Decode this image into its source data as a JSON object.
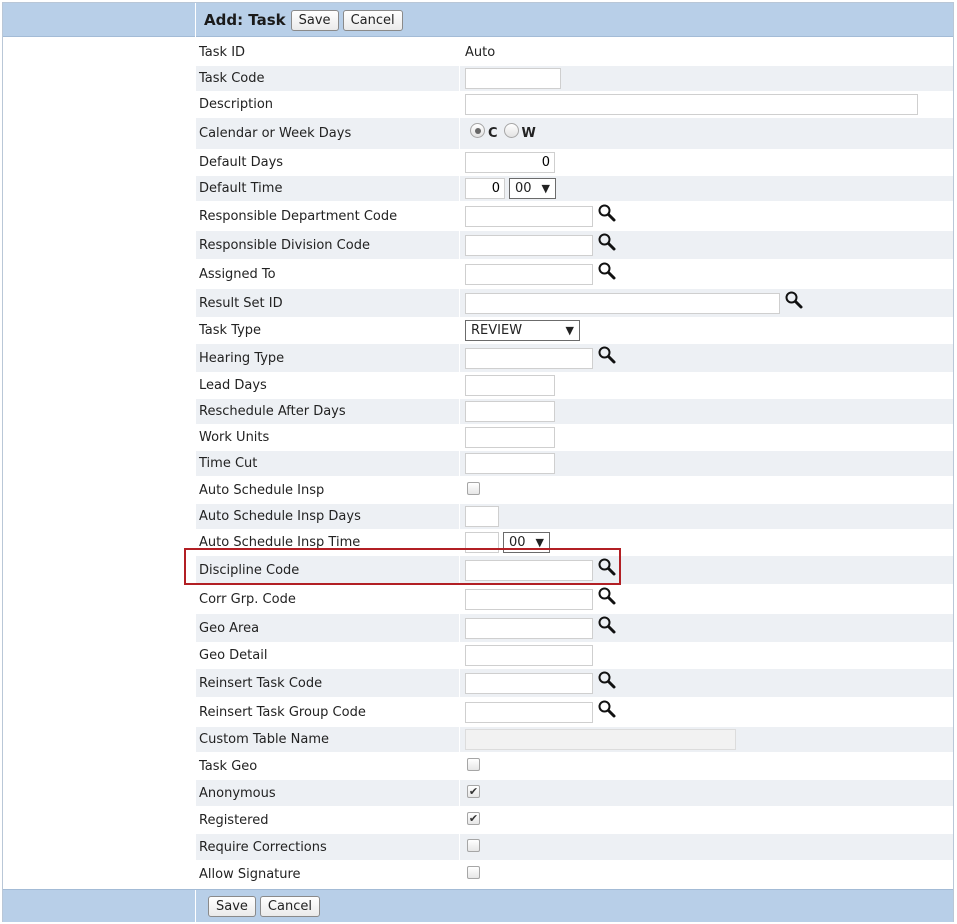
{
  "header": {
    "title": "Add: Task",
    "save_label": "Save",
    "cancel_label": "Cancel"
  },
  "footer": {
    "save_label": "Save",
    "cancel_label": "Cancel"
  },
  "fields": {
    "task_id": {
      "label": "Task ID",
      "value": "Auto"
    },
    "task_code": {
      "label": "Task Code",
      "value": ""
    },
    "description": {
      "label": "Description",
      "value": ""
    },
    "calendar_or_week_days": {
      "label": "Calendar or Week Days",
      "options": [
        "C",
        "W"
      ],
      "selected": "C"
    },
    "default_days": {
      "label": "Default Days",
      "value": "0"
    },
    "default_time": {
      "label": "Default Time",
      "hours": "0",
      "minutes": "00"
    },
    "responsible_department_code": {
      "label": "Responsible Department Code",
      "value": ""
    },
    "responsible_division_code": {
      "label": "Responsible Division Code",
      "value": ""
    },
    "assigned_to": {
      "label": "Assigned To",
      "value": ""
    },
    "result_set_id": {
      "label": "Result Set ID",
      "value": ""
    },
    "task_type": {
      "label": "Task Type",
      "selected": "REVIEW"
    },
    "hearing_type": {
      "label": "Hearing Type",
      "value": ""
    },
    "lead_days": {
      "label": "Lead Days",
      "value": ""
    },
    "reschedule_after_days": {
      "label": "Reschedule After Days",
      "value": ""
    },
    "work_units": {
      "label": "Work Units",
      "value": ""
    },
    "time_cut": {
      "label": "Time Cut",
      "value": ""
    },
    "auto_schedule_insp": {
      "label": "Auto Schedule Insp",
      "checked": false
    },
    "auto_schedule_insp_days": {
      "label": "Auto Schedule Insp Days",
      "value": ""
    },
    "auto_schedule_insp_time": {
      "label": "Auto Schedule Insp Time",
      "hours": "",
      "minutes": "00"
    },
    "discipline_code": {
      "label": "Discipline Code",
      "value": ""
    },
    "corr_grp_code": {
      "label": "Corr Grp. Code",
      "value": ""
    },
    "geo_area": {
      "label": "Geo Area",
      "value": ""
    },
    "geo_detail": {
      "label": "Geo Detail",
      "value": ""
    },
    "reinsert_task_code": {
      "label": "Reinsert Task Code",
      "value": ""
    },
    "reinsert_task_group_code": {
      "label": "Reinsert Task Group Code",
      "value": ""
    },
    "custom_table_name": {
      "label": "Custom Table Name",
      "value": ""
    },
    "task_geo": {
      "label": "Task Geo",
      "checked": false
    },
    "anonymous": {
      "label": "Anonymous",
      "checked": true
    },
    "registered": {
      "label": "Registered",
      "checked": true
    },
    "require_corrections": {
      "label": "Require Corrections",
      "checked": false
    },
    "allow_signature": {
      "label": "Allow Signature",
      "checked": false
    }
  },
  "icons": {
    "lookup": "magnifier-icon",
    "dropdown": "dropdown-arrow-icon",
    "check": "checkmark-icon"
  },
  "colors": {
    "header_bg": "#b8cfe8",
    "row_alt_bg": "#edf0f4",
    "highlight": "#b21f24"
  }
}
